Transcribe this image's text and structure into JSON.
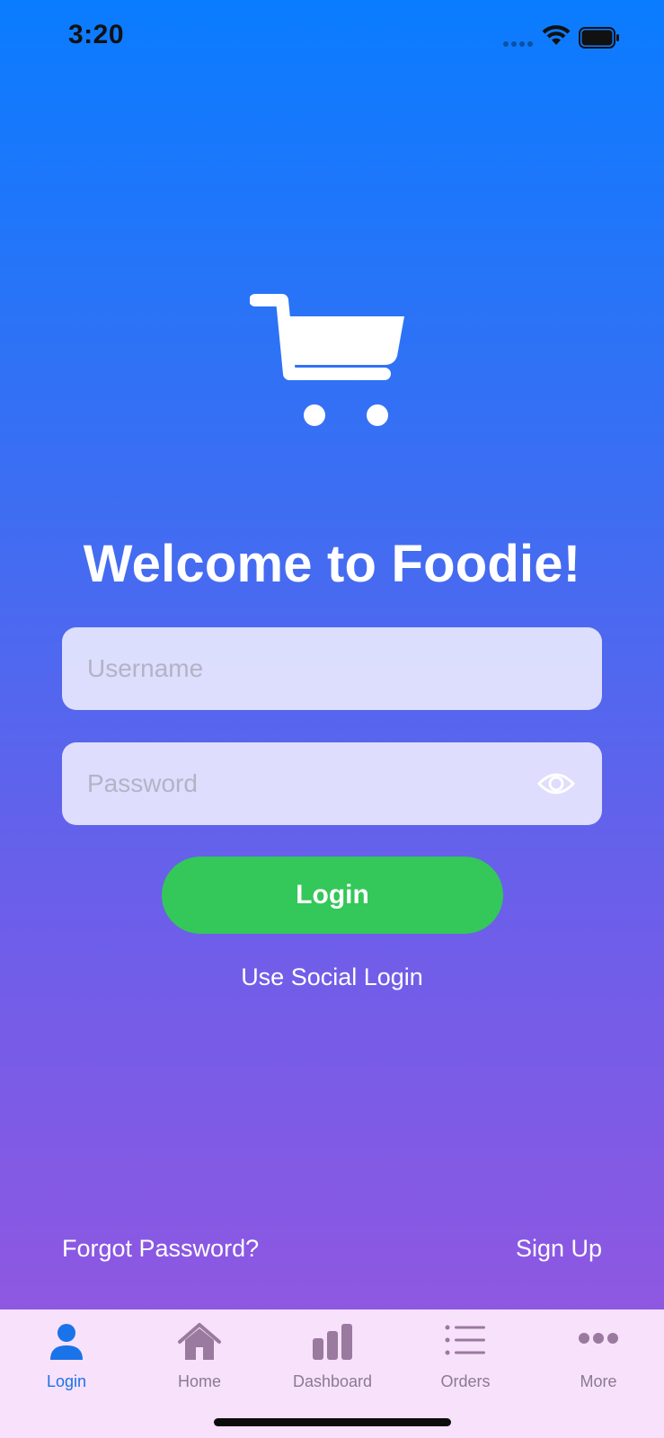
{
  "status_bar": {
    "time": "3:20"
  },
  "branding": {
    "logo_icon": "shopping-cart-icon",
    "welcome_title": "Welcome to Foodie!"
  },
  "form": {
    "username": {
      "placeholder": "Username",
      "value": ""
    },
    "password": {
      "placeholder": "Password",
      "value": "",
      "toggle_icon": "eye-icon"
    },
    "login_label": "Login",
    "social_login_label": "Use Social Login",
    "forgot_password_label": "Forgot Password?",
    "sign_up_label": "Sign Up"
  },
  "tab_bar": {
    "items": [
      {
        "label": "Login",
        "icon": "person-icon",
        "active": true
      },
      {
        "label": "Home",
        "icon": "house-icon",
        "active": false
      },
      {
        "label": "Dashboard",
        "icon": "bar-chart-icon",
        "active": false
      },
      {
        "label": "Orders",
        "icon": "list-icon",
        "active": false
      },
      {
        "label": "More",
        "icon": "ellipsis-icon",
        "active": false
      }
    ]
  },
  "colors": {
    "gradient_top": "#0a7cff",
    "gradient_bottom": "#9a55df",
    "login_button": "#34c759",
    "tab_active": "#1a73e8",
    "tab_inactive": "#8a7a92",
    "tab_bar_bg": "#f8e1fb"
  }
}
